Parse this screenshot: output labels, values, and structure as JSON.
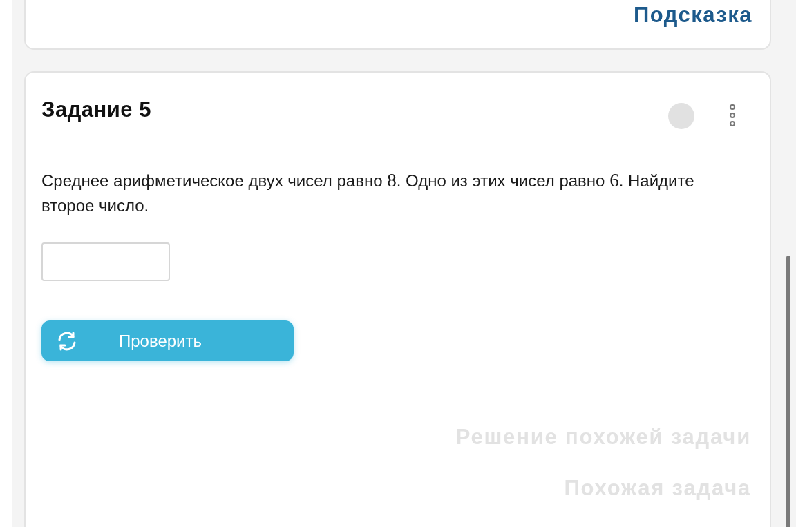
{
  "hint_card": {
    "link": {
      "label": "Подсказка",
      "disabled": false
    }
  },
  "task": {
    "title": "Задание 5",
    "problem": [
      {
        "kind": "text",
        "text": "Среднее арифметическое двух чисел равно "
      },
      {
        "kind": "math",
        "text": "8"
      },
      {
        "kind": "text",
        "text": ". Одно из этих чисел равно "
      },
      {
        "kind": "math",
        "text": "6"
      },
      {
        "kind": "text",
        "text": ". Найдите второе число."
      }
    ],
    "check_button": "Проверить",
    "links": [
      {
        "label": "Решение похожей задачи",
        "disabled": true
      },
      {
        "label": "Похожая задача",
        "disabled": true
      }
    ]
  }
}
